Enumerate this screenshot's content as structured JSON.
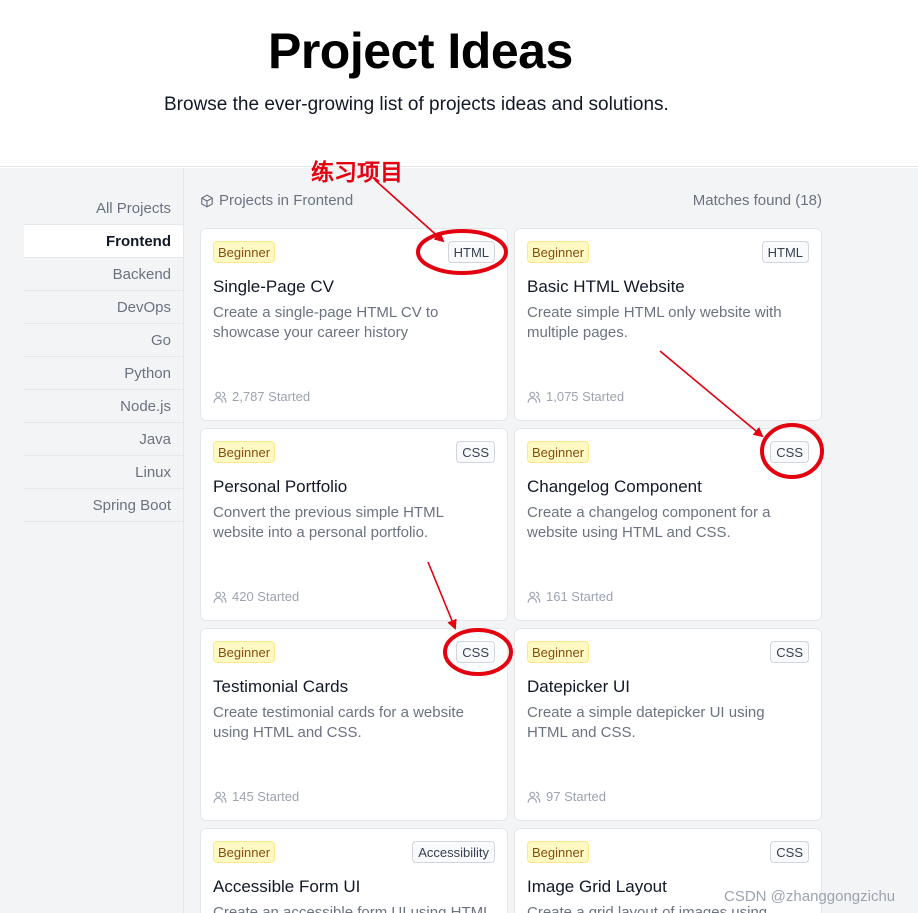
{
  "hero": {
    "title": "Project Ideas",
    "subtitle": "Browse the ever-growing list of projects ideas and solutions."
  },
  "sidebar": {
    "items": [
      {
        "label": "All Projects",
        "active": false
      },
      {
        "label": "Frontend",
        "active": true
      },
      {
        "label": "Backend",
        "active": false
      },
      {
        "label": "DevOps",
        "active": false
      },
      {
        "label": "Go",
        "active": false
      },
      {
        "label": "Python",
        "active": false
      },
      {
        "label": "Node.js",
        "active": false
      },
      {
        "label": "Java",
        "active": false
      },
      {
        "label": "Linux",
        "active": false
      },
      {
        "label": "Spring Boot",
        "active": false
      }
    ]
  },
  "list": {
    "heading": "Projects in Frontend",
    "heading_icon": "cube-icon",
    "matches": "Matches found (18)"
  },
  "cards": [
    {
      "level": "Beginner",
      "tech": "HTML",
      "title": "Single-Page CV",
      "description": "Create a single-page HTML CV to showcase your career history",
      "started": "2,787 Started"
    },
    {
      "level": "Beginner",
      "tech": "HTML",
      "title": "Basic HTML Website",
      "description": "Create simple HTML only website with multiple pages.",
      "started": "1,075 Started"
    },
    {
      "level": "Beginner",
      "tech": "CSS",
      "title": "Personal Portfolio",
      "description": "Convert the previous simple HTML website into a personal portfolio.",
      "started": "420 Started"
    },
    {
      "level": "Beginner",
      "tech": "CSS",
      "title": "Changelog Component",
      "description": "Create a changelog component for a website using HTML and CSS.",
      "started": "161 Started"
    },
    {
      "level": "Beginner",
      "tech": "CSS",
      "title": "Testimonial Cards",
      "description": "Create testimonial cards for a website using HTML and CSS.",
      "started": "145 Started"
    },
    {
      "level": "Beginner",
      "tech": "CSS",
      "title": "Datepicker UI",
      "description": "Create a simple datepicker UI using HTML and CSS.",
      "started": "97 Started"
    },
    {
      "level": "Beginner",
      "tech": "Accessibility",
      "title": "Accessible Form UI",
      "description": "Create an accessible form UI using HTML",
      "started": ""
    },
    {
      "level": "Beginner",
      "tech": "CSS",
      "title": "Image Grid Layout",
      "description": "Create a grid layout of images using",
      "started": ""
    }
  ],
  "annotation": {
    "label": "练习项目",
    "color": "#e3000f"
  },
  "watermark": "CSDN @zhanggongzichu",
  "colors": {
    "beginner_bg": "#fef9c3",
    "beginner_text": "#854d0e",
    "page_bg": "#f3f4f6"
  }
}
